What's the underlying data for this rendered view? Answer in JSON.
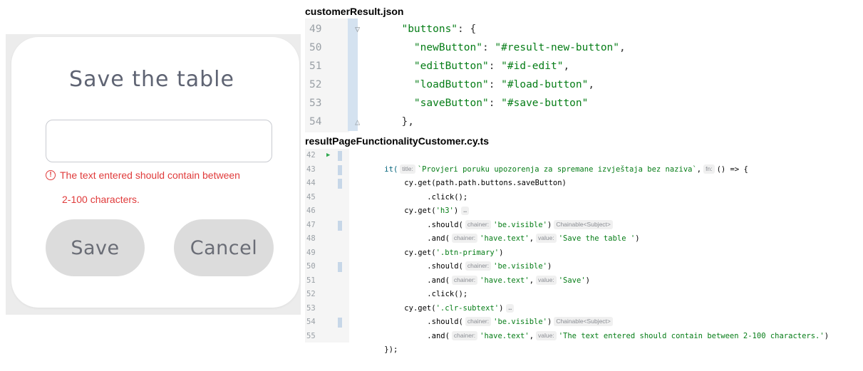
{
  "dialog": {
    "title": "Save the table",
    "input_value": "",
    "error_line1": "The text entered should contain between",
    "error_line2": "2-100 characters.",
    "save_label": "Save",
    "cancel_label": "Cancel",
    "error_color": "#e03b3b"
  },
  "files": {
    "json_name": "customerResult.json",
    "ts_name": "resultPageFunctionalityCustomer.cy.ts"
  },
  "json_lines": [
    {
      "n": "49",
      "text": "  \"buttons\": {",
      "fold": "▽"
    },
    {
      "n": "50",
      "text": "    \"newButton\": \"#result-new-button\",",
      "fold": ""
    },
    {
      "n": "51",
      "text": "    \"editButton\": \"#id-edit\",",
      "fold": ""
    },
    {
      "n": "52",
      "text": "    \"loadButton\": \"#load-button\",",
      "fold": ""
    },
    {
      "n": "53",
      "text": "    \"saveButton\": \"#save-button\"",
      "fold": ""
    },
    {
      "n": "54",
      "text": "  },",
      "fold": "△"
    }
  ],
  "ts_lines": [
    {
      "n": "42"
    },
    {
      "n": "43"
    },
    {
      "n": "44"
    },
    {
      "n": "45"
    },
    {
      "n": "46"
    },
    {
      "n": "47"
    },
    {
      "n": "48"
    },
    {
      "n": "49"
    },
    {
      "n": "50"
    },
    {
      "n": "51"
    },
    {
      "n": "52"
    },
    {
      "n": "53"
    },
    {
      "n": "54"
    },
    {
      "n": "55"
    }
  ],
  "ts_code": {
    "l42_it": "it(",
    "l42_hint_title": "title:",
    "l42_str": "`Provjeri poruku upozorenja za spremane izvještaja bez naziva`",
    "l42_hint_fn": "fn:",
    "l42_rest": "() => {",
    "l43": "cy.get(path.path.buttons.saveButton)",
    "l44": ".click();",
    "l45_a": "cy.get(",
    "l45_str": "'h3'",
    "l45_b": ")",
    "fold_dots": "…",
    "should": ".should(",
    "and": ".and(",
    "hint_chainer": "chainer:",
    "hint_value": "value:",
    "be_visible": "'be.visible'",
    "have_text": "'have.text'",
    "chainable": "Chainable<Subject>",
    "close_paren": ")",
    "close_paren_semi": ")",
    "l47_val": "'Save the table '",
    "l48_a": "cy.get(",
    "l48_str": "'.btn-primary'",
    "l48_b": ")",
    "l50_val": "'Save'",
    "l51": ".click();",
    "l52_a": "cy.get(",
    "l52_str": "'.clr-subtext'",
    "l52_b": ")",
    "l54_val": "'The text entered should contain between 2-100 characters.'",
    "l55": "});",
    "comma": ","
  }
}
